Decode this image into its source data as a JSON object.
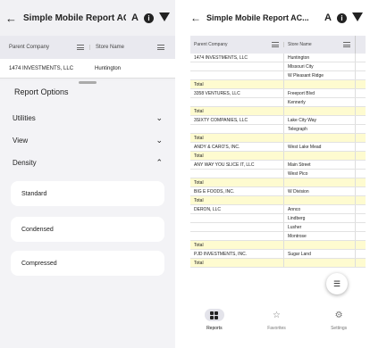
{
  "app": {
    "title": "Simple Mobile Report AC...",
    "back_icon": "arrow-left-icon",
    "font_icon_label": "A"
  },
  "left": {
    "columns": [
      "Parent Company",
      "Store Name"
    ],
    "row": {
      "company": "1474 INVESTMENTS, LLC",
      "store": "Huntington"
    },
    "sheet": {
      "title": "Report Options",
      "sections": [
        {
          "label": "Utilities",
          "state": "collapsed"
        },
        {
          "label": "View",
          "state": "collapsed"
        },
        {
          "label": "Density",
          "state": "expanded"
        }
      ],
      "density_options": [
        "Standard",
        "Condensed",
        "Compressed"
      ]
    }
  },
  "right": {
    "columns": [
      "Parent Company",
      "Store Name"
    ],
    "total_label": "Total",
    "rows": [
      {
        "company": "1474 INVESTMENTS, LLC",
        "store": "Huntington",
        "total": false
      },
      {
        "company": "",
        "store": "Missouri City",
        "total": false
      },
      {
        "company": "",
        "store": "W Pleasant Ridge",
        "total": false
      },
      {
        "company": "Total",
        "store": "",
        "total": true
      },
      {
        "company": "3358 VENTURES, LLC",
        "store": "Freeport Blvd",
        "total": false
      },
      {
        "company": "",
        "store": "Kennerly",
        "total": false
      },
      {
        "company": "Total",
        "store": "",
        "total": true
      },
      {
        "company": "3SIXTY COMPANIES, LLC",
        "store": "Lake City Way",
        "total": false
      },
      {
        "company": "",
        "store": "Telegraph",
        "total": false
      },
      {
        "company": "Total",
        "store": "",
        "total": true
      },
      {
        "company": "ANDY & CARO'S, INC.",
        "store": "West Lake Mead",
        "total": false
      },
      {
        "company": "Total",
        "store": "",
        "total": true
      },
      {
        "company": "ANY WAY YOU SLICE IT, LLC",
        "store": "Main Street",
        "total": false
      },
      {
        "company": "",
        "store": "West Pico",
        "total": false
      },
      {
        "company": "Total",
        "store": "",
        "total": true
      },
      {
        "company": "BIG E FOODS, INC.",
        "store": "W Division",
        "total": false
      },
      {
        "company": "Total",
        "store": "",
        "total": true
      },
      {
        "company": "DERON, LLC",
        "store": "Annco",
        "total": false
      },
      {
        "company": "",
        "store": "Lindberg",
        "total": false
      },
      {
        "company": "",
        "store": "Lusher",
        "total": false
      },
      {
        "company": "",
        "store": "Montrose",
        "total": false
      },
      {
        "company": "Total",
        "store": "",
        "total": true
      },
      {
        "company": "PJD INVESTMENTS, INC.",
        "store": "Sugar Land",
        "total": false
      },
      {
        "company": "Total",
        "store": "",
        "total": true
      }
    ],
    "nav": [
      {
        "label": "Reports",
        "icon": "grid-icon",
        "active": true
      },
      {
        "label": "Favorites",
        "icon": "star-icon",
        "active": false
      },
      {
        "label": "Settings",
        "icon": "gear-icon",
        "active": false
      }
    ]
  },
  "colors": {
    "total_row": "#fefbd0",
    "header_bg": "#e9e9ef",
    "accent": "#222222"
  }
}
